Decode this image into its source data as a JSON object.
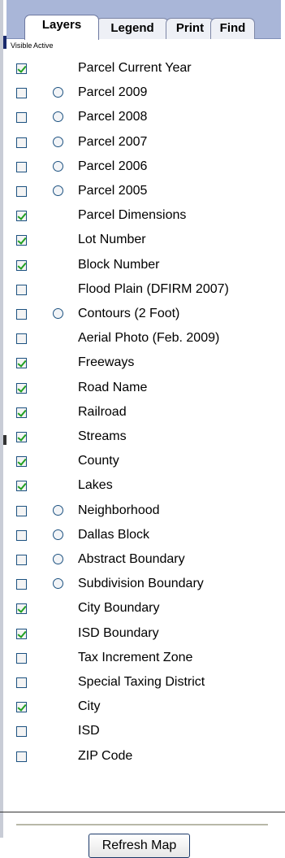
{
  "tabs": {
    "layers": "Layers",
    "legend": "Legend",
    "print": "Print",
    "find": "Find",
    "active_tab": "Layers"
  },
  "columns": {
    "visible": "Visible",
    "active": "Active"
  },
  "layers": [
    {
      "label": "Parcel Current Year",
      "visible": true,
      "has_active_radio": false
    },
    {
      "label": "Parcel 2009",
      "visible": false,
      "has_active_radio": true
    },
    {
      "label": "Parcel 2008",
      "visible": false,
      "has_active_radio": true
    },
    {
      "label": "Parcel 2007",
      "visible": false,
      "has_active_radio": true
    },
    {
      "label": "Parcel 2006",
      "visible": false,
      "has_active_radio": true
    },
    {
      "label": "Parcel 2005",
      "visible": false,
      "has_active_radio": true
    },
    {
      "label": "Parcel Dimensions",
      "visible": true,
      "has_active_radio": false
    },
    {
      "label": "Lot Number",
      "visible": true,
      "has_active_radio": false
    },
    {
      "label": "Block Number",
      "visible": true,
      "has_active_radio": false
    },
    {
      "label": "Flood Plain (DFIRM 2007)",
      "visible": false,
      "has_active_radio": false
    },
    {
      "label": "Contours (2 Foot)",
      "visible": false,
      "has_active_radio": true
    },
    {
      "label": "Aerial Photo (Feb. 2009)",
      "visible": false,
      "has_active_radio": false
    },
    {
      "label": "Freeways",
      "visible": true,
      "has_active_radio": false
    },
    {
      "label": "Road Name",
      "visible": true,
      "has_active_radio": false
    },
    {
      "label": "Railroad",
      "visible": true,
      "has_active_radio": false
    },
    {
      "label": "Streams",
      "visible": true,
      "has_active_radio": false
    },
    {
      "label": "County",
      "visible": true,
      "has_active_radio": false
    },
    {
      "label": "Lakes",
      "visible": true,
      "has_active_radio": false
    },
    {
      "label": "Neighborhood",
      "visible": false,
      "has_active_radio": true
    },
    {
      "label": "Dallas Block",
      "visible": false,
      "has_active_radio": true
    },
    {
      "label": "Abstract Boundary",
      "visible": false,
      "has_active_radio": true
    },
    {
      "label": "Subdivision Boundary",
      "visible": false,
      "has_active_radio": true
    },
    {
      "label": "City Boundary",
      "visible": true,
      "has_active_radio": false
    },
    {
      "label": "ISD Boundary",
      "visible": true,
      "has_active_radio": false
    },
    {
      "label": "Tax Increment Zone",
      "visible": false,
      "has_active_radio": false
    },
    {
      "label": "Special Taxing District",
      "visible": false,
      "has_active_radio": false
    },
    {
      "label": "City",
      "visible": true,
      "has_active_radio": false
    },
    {
      "label": "ISD",
      "visible": false,
      "has_active_radio": false
    },
    {
      "label": "ZIP Code",
      "visible": false,
      "has_active_radio": false
    }
  ],
  "footer": {
    "refresh_label": "Refresh Map"
  },
  "colors": {
    "tab_strip": "#a9b6d8",
    "check_mark": "#21a121",
    "control_border": "#1c5180"
  }
}
